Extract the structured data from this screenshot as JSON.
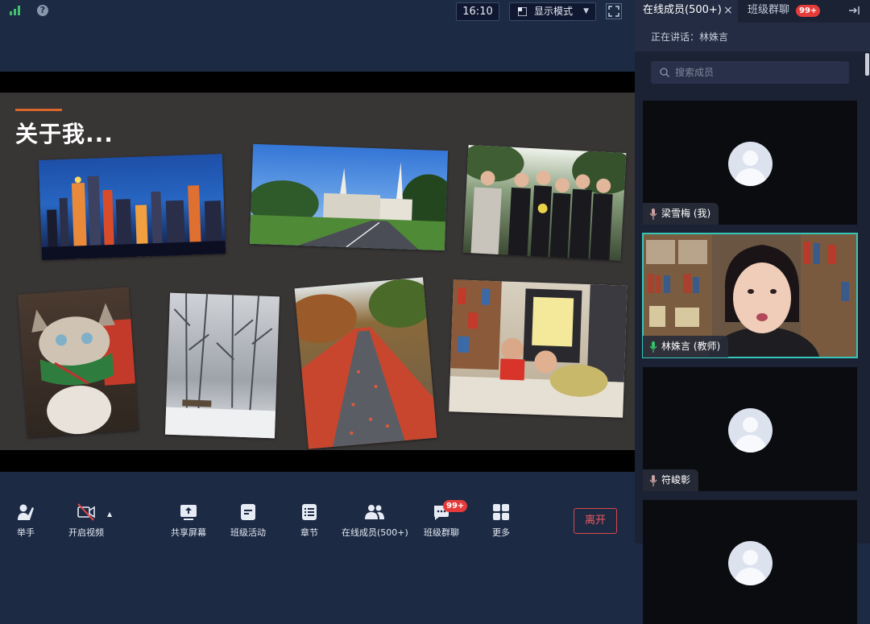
{
  "top_bar": {
    "help_label": "?",
    "clock": "16:10",
    "display_mode_label": "显示模式",
    "caret": "▼"
  },
  "slide": {
    "title": "关于我..."
  },
  "panel": {
    "tab_members_label": "在线成员(500+)",
    "tab_close": "×",
    "tab_chat_label": "班级群聊",
    "tab_chat_badge": "99+",
    "speaking_label": "正在讲话：林姝言",
    "search_placeholder": "搜索成员",
    "tiles": [
      {
        "name": "梁雪梅 (我)",
        "mic": "muted"
      },
      {
        "name": "林姝言 (教师)",
        "mic": "active"
      },
      {
        "name": "符峻彰",
        "mic": "muted"
      }
    ]
  },
  "toolbar": {
    "raise_hand": "举手",
    "start_video": "开启视频",
    "caret": "▲",
    "share_screen": "共享屏幕",
    "class_activity": "班级活动",
    "chapters": "章节",
    "members": "在线成员(500+)",
    "group_chat": "班级群聊",
    "group_chat_badge": "99+",
    "more": "更多",
    "leave": "离开"
  },
  "colors": {
    "background": "#1c2a44",
    "panel": "#1b2234",
    "slide": "#383535",
    "accent": "#d9662c",
    "active_tile_border": "#35c6b8",
    "danger": "#e53b3b"
  }
}
